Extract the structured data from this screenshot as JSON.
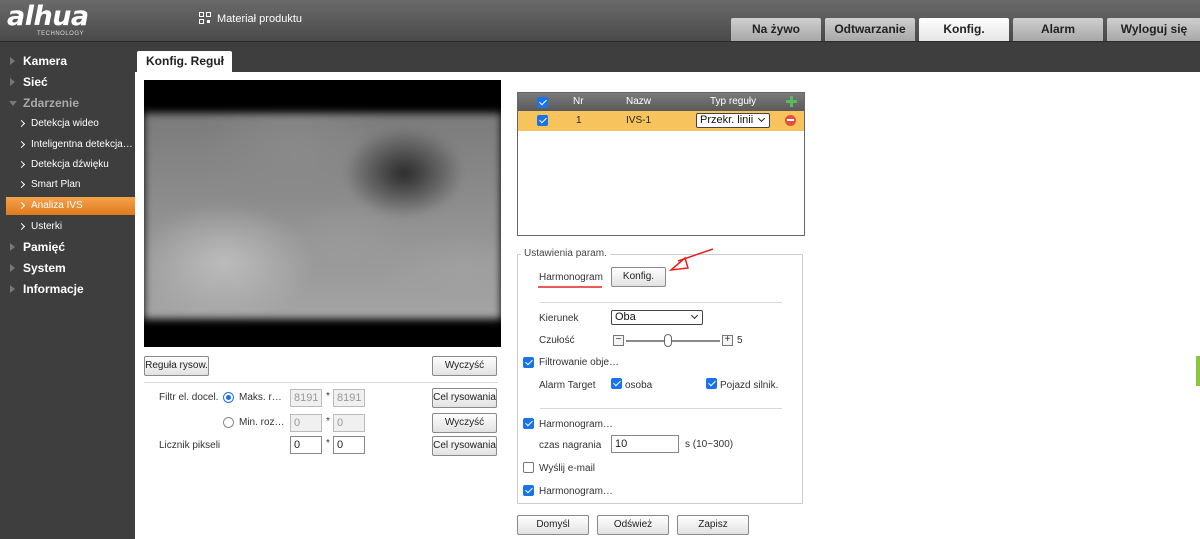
{
  "header": {
    "logo_text": "alhua",
    "logo_subtext": "TECHNOLOGY",
    "material_label": "Materiał produktu",
    "nav": [
      "Na żywo",
      "Odtwarzanie",
      "Konfig.",
      "Alarm",
      "Wyloguj się"
    ],
    "active_nav": "Konfig."
  },
  "sidebar": {
    "groups": [
      "Kamera",
      "Sieć",
      "Zdarzenie",
      "Pamięć",
      "System",
      "Informacje"
    ],
    "subitems": [
      "Detekcja wideo",
      "Inteligentna detekcja r…",
      "Detekcja dźwięku",
      "Smart Plan",
      "Analiza IVS",
      "Usterki"
    ],
    "active_subitem": "Analiza IVS"
  },
  "page_tab": "Konfig. Reguł",
  "left_controls": {
    "draw_rule_btn": "Reguła rysow.",
    "clear_btn_1": "Wyczyść",
    "filter_label": "Filtr el. docel.",
    "max_label": "Maks. r…",
    "max_w": "8191",
    "max_h": "8191",
    "min_label": "Min. roz…",
    "min_w": "0",
    "min_h": "0",
    "times": "*",
    "target_btn_1": "Cel rysowania",
    "clear_btn_2": "Wyczyść",
    "pixel_counter_label": "Licznik pikseli",
    "pixel_w": "0",
    "pixel_h": "0",
    "target_btn_2": "Cel rysowania"
  },
  "rule_table": {
    "headers": [
      "Nr",
      "Nazw",
      "Typ reguły"
    ],
    "rows": [
      {
        "nr": "1",
        "name": "IVS-1",
        "type": "Przekr. linii"
      }
    ]
  },
  "settings": {
    "legend": "Ustawienia param.",
    "schedule_label": "Harmonogram",
    "config_btn": "Konfig.",
    "direction_label": "Kierunek",
    "direction_value": "Oba",
    "sensitivity_label": "Czułość",
    "sensitivity_value": "5",
    "sensitivity_min_symbol": "−",
    "sensitivity_max_symbol": "+",
    "object_filter": "Filtrowanie obje…",
    "alarm_target_label": "Alarm Target",
    "alarm_target_person": "osoba",
    "alarm_target_vehicle": "Pojazd silnik.",
    "schedule_check_1": "Harmonogram…",
    "record_time_label": "czas nagrania",
    "record_time_value": "10",
    "record_time_range": "s (10~300)",
    "send_email": "Wyślij e-mail",
    "schedule_check_2": "Harmonogram…"
  },
  "footer_buttons": {
    "default": "Domyśl",
    "refresh": "Odśwież",
    "save": "Zapisz"
  },
  "colors": {
    "accent_orange": "#e8861f",
    "selected_row": "#f7c35c",
    "checkbox_blue": "#1a73e8",
    "annotation_red": "#e8211f"
  }
}
